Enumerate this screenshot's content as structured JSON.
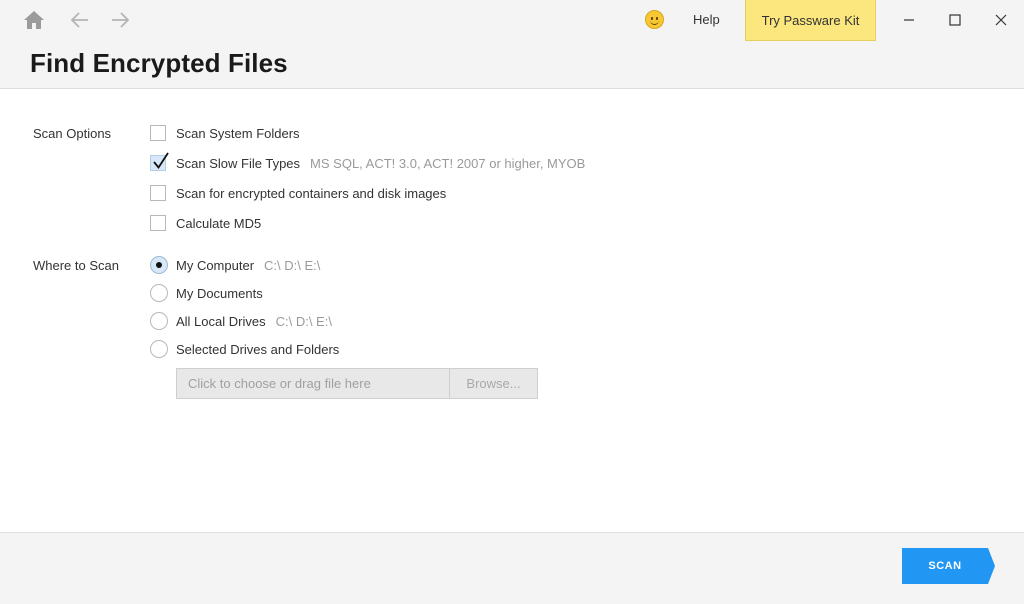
{
  "header": {
    "help_label": "Help",
    "try_label": "Try Passware Kit",
    "title": "Find Encrypted Files"
  },
  "icons": {
    "home": "home-icon",
    "back": "arrow-left-icon",
    "forward": "arrow-right-icon",
    "feedback": "smiley-icon",
    "minimize": "minimize-icon",
    "maximize": "maximize-icon",
    "close": "close-icon"
  },
  "scan_options": {
    "label": "Scan Options",
    "items": [
      {
        "label": "Scan System Folders",
        "hint": "",
        "checked": false
      },
      {
        "label": "Scan Slow File Types",
        "hint": "MS SQL, ACT! 3.0, ACT! 2007 or higher, MYOB",
        "checked": true
      },
      {
        "label": "Scan for encrypted containers and disk images",
        "hint": "",
        "checked": false
      },
      {
        "label": "Calculate MD5",
        "hint": "",
        "checked": false
      }
    ]
  },
  "where_to_scan": {
    "label": "Where to Scan",
    "items": [
      {
        "label": "My Computer",
        "hint": "C:\\ D:\\ E:\\",
        "selected": true
      },
      {
        "label": "My Documents",
        "hint": "",
        "selected": false
      },
      {
        "label": "All Local Drives",
        "hint": "C:\\ D:\\ E:\\",
        "selected": false
      },
      {
        "label": "Selected Drives and Folders",
        "hint": "",
        "selected": false
      }
    ],
    "file_picker": {
      "placeholder": "Click to choose or drag file here",
      "browse_label": "Browse..."
    }
  },
  "footer": {
    "scan_label": "SCAN"
  },
  "colors": {
    "accent": "#2196f3",
    "try_button": "#fbe77e",
    "background": "#f4f4f4",
    "content_background": "#ffffff"
  }
}
